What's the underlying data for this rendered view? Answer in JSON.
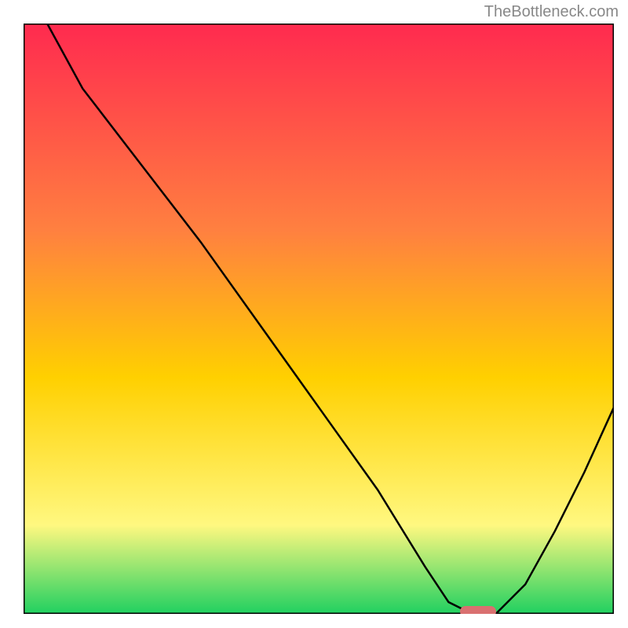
{
  "watermark": "TheBottleneck.com",
  "chart_data": {
    "type": "line",
    "title": "",
    "xlabel": "",
    "ylabel": "",
    "xlim": [
      0,
      100
    ],
    "ylim": [
      0,
      100
    ],
    "series": [
      {
        "name": "bottleneck-curve",
        "x": [
          4,
          10,
          20,
          30,
          40,
          50,
          60,
          68,
          72,
          76,
          80,
          85,
          90,
          95,
          100
        ],
        "y": [
          100,
          89,
          76,
          63,
          49,
          35,
          21,
          8,
          2,
          0,
          0,
          5,
          14,
          24,
          35
        ]
      }
    ],
    "marker": {
      "name": "optimal-point",
      "x": 77,
      "y": 0,
      "color": "#d97070"
    },
    "background_gradient": {
      "top": "#ff2a4f",
      "mid1": "#ff8040",
      "mid2": "#ffd000",
      "mid3": "#fff880",
      "bottom": "#20d060"
    }
  }
}
